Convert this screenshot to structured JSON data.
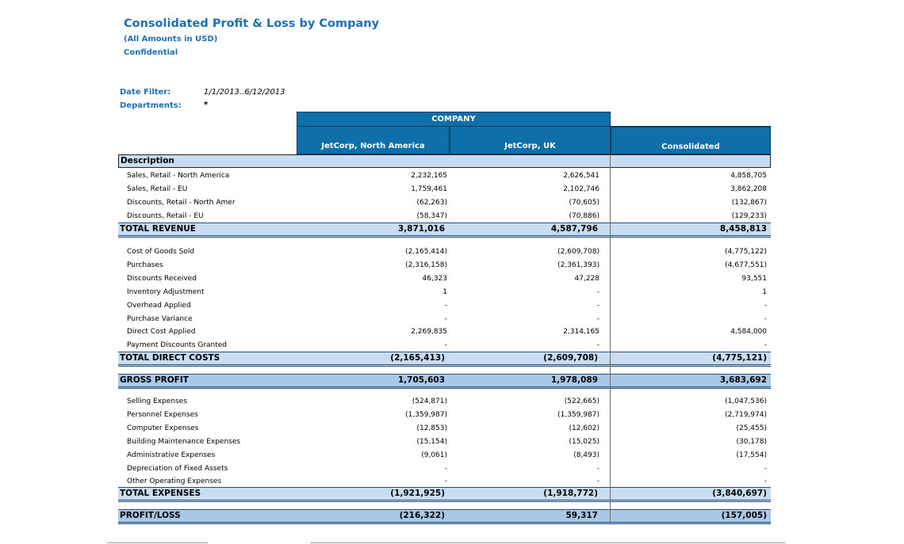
{
  "header": {
    "title": "Consolidated Profit & Loss by Company",
    "subtitle": "(All Amounts in USD)",
    "confidential": "Confidential"
  },
  "filters": {
    "date_label": "Date Filter:",
    "date_value": "1/1/2013..6/12/2013",
    "dept_label": "Departments:",
    "dept_value": "*"
  },
  "columns": {
    "group": "COMPANY",
    "c1": "JetCorp, North America",
    "c2": "JetCorp, UK",
    "c3": "Consolidated",
    "description": "Description"
  },
  "revenue": [
    {
      "label": "Sales, Retail - North America",
      "v1": "2,232,165",
      "v2": "2,626,541",
      "v3": "4,858,705"
    },
    {
      "label": "Sales, Retail - EU",
      "v1": "1,759,461",
      "v2": "2,102,746",
      "v3": "3,862,208"
    },
    {
      "label": "Discounts, Retail - North Amer",
      "v1": "(62,263)",
      "v2": "(70,605)",
      "v3": "(132,867)"
    },
    {
      "label": "Discounts, Retail - EU",
      "v1": "(58,347)",
      "v2": "(70,886)",
      "v3": "(129,233)"
    }
  ],
  "total_revenue": {
    "label": "TOTAL REVENUE",
    "v1": "3,871,016",
    "v2": "4,587,796",
    "v3": "8,458,813"
  },
  "direct_costs": [
    {
      "label": "Cost of Goods Sold",
      "v1": "(2,165,414)",
      "v2": "(2,609,708)",
      "v3": "(4,775,122)"
    },
    {
      "label": "Purchases",
      "v1": "(2,316,158)",
      "v2": "(2,361,393)",
      "v3": "(4,677,551)"
    },
    {
      "label": "Discounts Received",
      "v1": "46,323",
      "v2": "47,228",
      "v3": "93,551"
    },
    {
      "label": "Inventory Adjustment",
      "v1": "1",
      "v2": "-",
      "v3": "1"
    },
    {
      "label": "Overhead Applied",
      "v1": "-",
      "v2": "-",
      "v3": "-"
    },
    {
      "label": "Purchase Variance",
      "v1": "-",
      "v2": "-",
      "v3": "-"
    },
    {
      "label": "Direct Cost Applied",
      "v1": "2,269,835",
      "v2": "2,314,165",
      "v3": "4,584,000"
    },
    {
      "label": "Payment Discounts Granted",
      "v1": "-",
      "v2": "-",
      "v3": "-"
    }
  ],
  "total_direct_costs": {
    "label": "TOTAL DIRECT COSTS",
    "v1": "(2,165,413)",
    "v2": "(2,609,708)",
    "v3": "(4,775,121)"
  },
  "gross_profit": {
    "label": "GROSS PROFIT",
    "v1": "1,705,603",
    "v2": "1,978,089",
    "v3": "3,683,692"
  },
  "expenses": [
    {
      "label": "Selling Expenses",
      "v1": "(524,871)",
      "v2": "(522,665)",
      "v3": "(1,047,536)"
    },
    {
      "label": "Personnel Expenses",
      "v1": "(1,359,987)",
      "v2": "(1,359,987)",
      "v3": "(2,719,974)"
    },
    {
      "label": "Computer Expenses",
      "v1": "(12,853)",
      "v2": "(12,602)",
      "v3": "(25,455)"
    },
    {
      "label": "Building Maintenance Expenses",
      "v1": "(15,154)",
      "v2": "(15,025)",
      "v3": "(30,178)"
    },
    {
      "label": "Administrative Expenses",
      "v1": "(9,061)",
      "v2": "(8,493)",
      "v3": "(17,554)"
    },
    {
      "label": "Depreciation of Fixed Assets",
      "v1": "-",
      "v2": "-",
      "v3": "-"
    },
    {
      "label": "Other Operating Expenses",
      "v1": "-",
      "v2": "-",
      "v3": "-"
    }
  ],
  "total_expenses": {
    "label": "TOTAL EXPENSES",
    "v1": "(1,921,925)",
    "v2": "(1,918,772)",
    "v3": "(3,840,697)"
  },
  "profit_loss": {
    "label": "PROFIT/LOSS",
    "v1": "(216,322)",
    "v2": "59,317",
    "v3": "(157,005)"
  },
  "colors": {
    "header_blue": "#0f6fa8",
    "title_blue": "#1f6fb5",
    "band_light": "#c8ddf1",
    "band_dark": "#a9c8e8"
  }
}
